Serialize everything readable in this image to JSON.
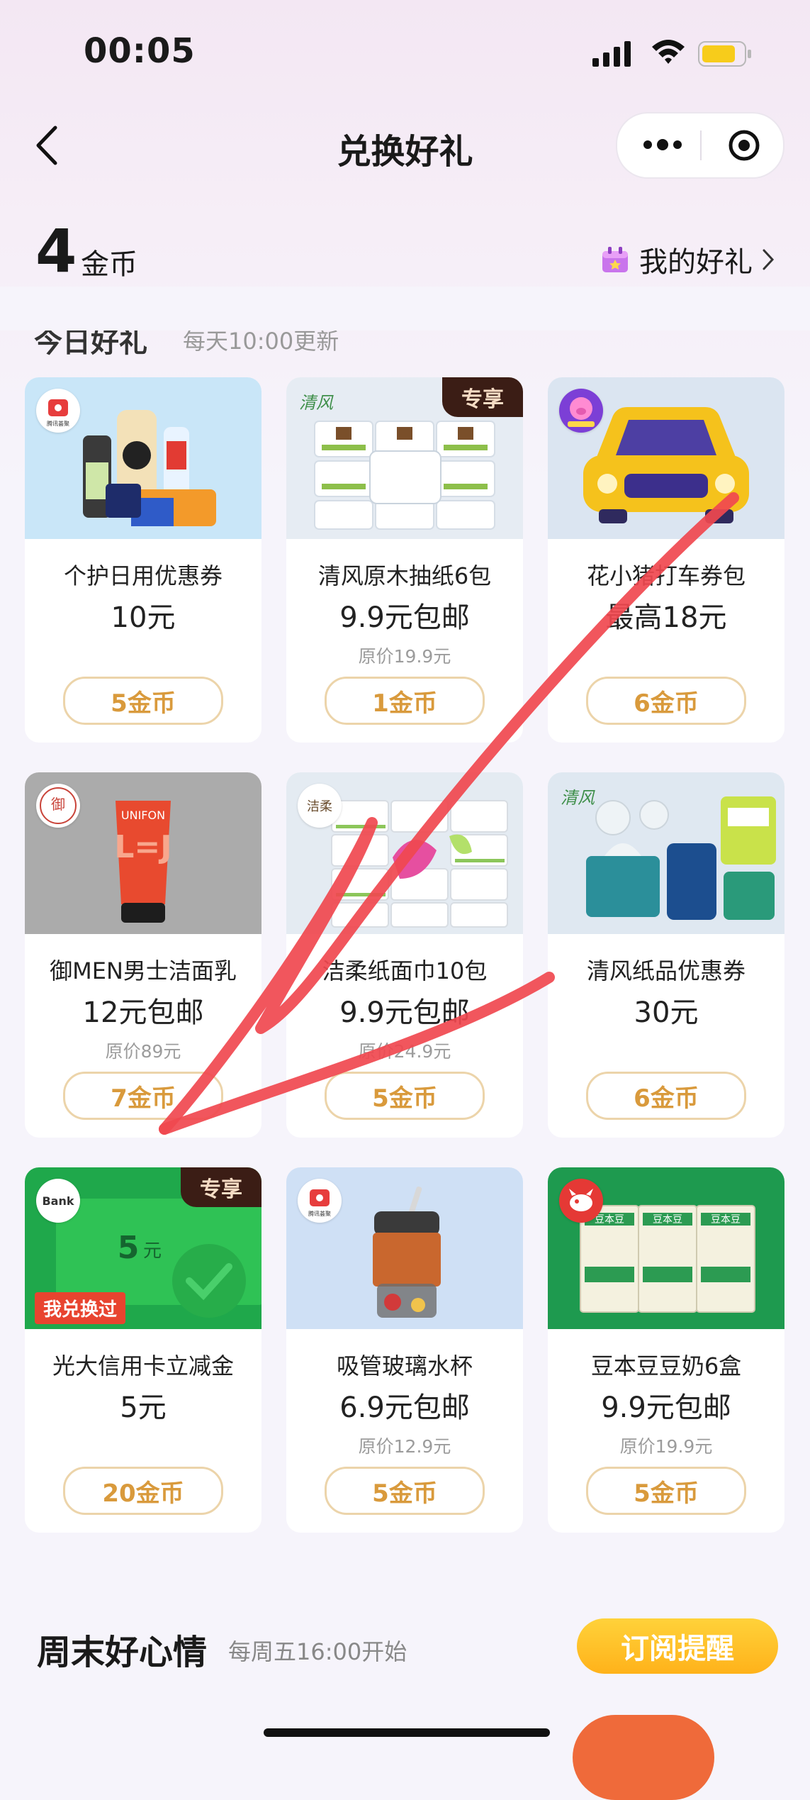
{
  "status_bar": {
    "time": "00:05"
  },
  "nav": {
    "title": "兑换好礼"
  },
  "coins": {
    "amount": "4",
    "unit": "金币"
  },
  "my_gifts": {
    "label": "我的好礼"
  },
  "section": {
    "title": "今日好礼",
    "subtitle": "每天10:00更新"
  },
  "products": [
    {
      "name": "个护日用优惠券",
      "price": "10元",
      "original": "",
      "cost": "5金币",
      "tag": ""
    },
    {
      "name": "清风原木抽纸6包",
      "price": "9.9元包邮",
      "original": "原价19.9元",
      "cost": "1金币",
      "tag": "专享"
    },
    {
      "name": "花小猪打车券包",
      "price": "最高18元",
      "original": "",
      "cost": "6金币",
      "tag": ""
    },
    {
      "name": "御MEN男士洁面乳",
      "price": "12元包邮",
      "original": "原价89元",
      "cost": "7金币",
      "tag": ""
    },
    {
      "name": "洁柔纸面巾10包",
      "price": "9.9元包邮",
      "original": "原价24.9元",
      "cost": "5金币",
      "tag": ""
    },
    {
      "name": "清风纸品优惠券",
      "price": "30元",
      "original": "",
      "cost": "6金币",
      "tag": ""
    },
    {
      "name": "光大信用卡立减金",
      "price": "5元",
      "original": "",
      "cost": "20金币",
      "tag": "专享"
    },
    {
      "name": "吸管玻璃水杯",
      "price": "6.9元包邮",
      "original": "原价12.9元",
      "cost": "5金币",
      "tag": ""
    },
    {
      "name": "豆本豆豆奶6盒",
      "price": "9.9元包邮",
      "original": "原价19.9元",
      "cost": "5金币",
      "tag": ""
    }
  ],
  "card_images": {
    "voucher_amount": "5",
    "voucher_unit": "元",
    "voucher_badge": "我兑换过",
    "bank_logo": "Bank",
    "brand_qingfeng": "清风",
    "brand_tencent": "腾讯荟聚",
    "brand_unifon": "UNIFON",
    "brand_yumen": "御",
    "brand_jierou": "洁柔",
    "brand_doubendou": "豆本豆"
  },
  "weekend": {
    "title": "周末好心情",
    "subtitle": "每周五16:00开始",
    "subscribe": "订阅提醒"
  },
  "colors": {
    "accent": "#d99a3c",
    "tag_bg": "#3b1d15",
    "subscribe": "#ffc023",
    "annotation": "#f0484f"
  },
  "icons": [
    "back-icon",
    "more-icon",
    "target-icon",
    "gift-icon",
    "chevron-right-icon",
    "signal-icon",
    "wifi-icon",
    "battery-icon"
  ]
}
